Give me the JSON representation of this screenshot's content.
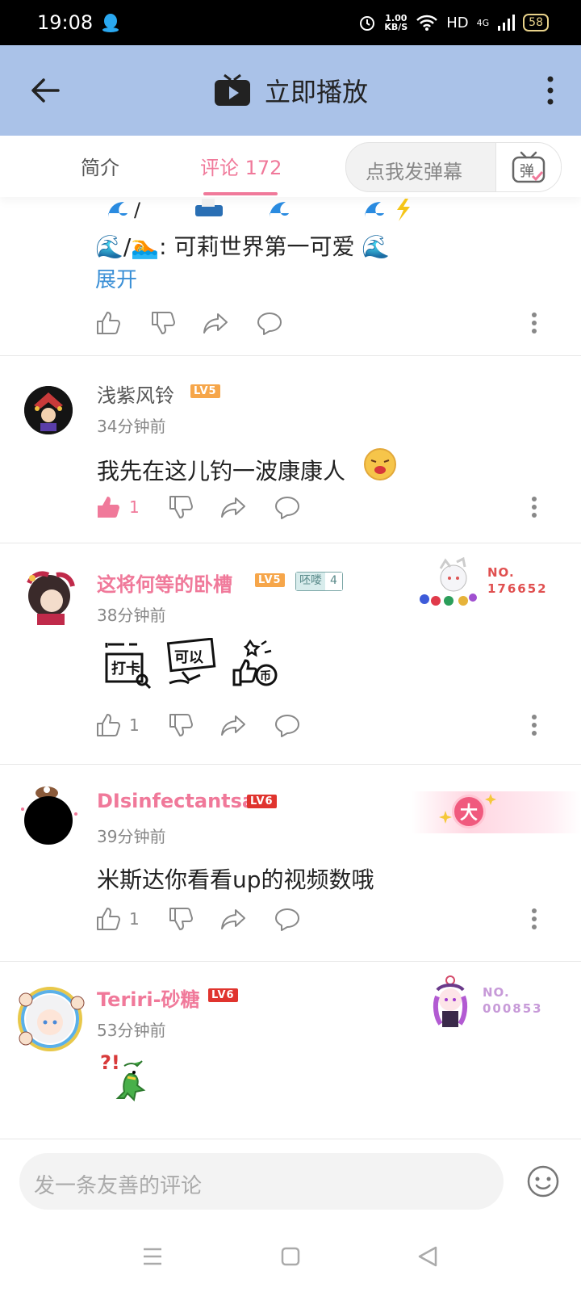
{
  "status_bar": {
    "time": "19:08",
    "speed_value": "1.00",
    "speed_unit": "KB/S",
    "network": "HD",
    "signal": "4G",
    "battery": "58"
  },
  "header": {
    "title": "立即播放"
  },
  "tabs": {
    "intro": "简介",
    "comments": "评论 172",
    "danmaku_placeholder": "点我发弹幕",
    "danmaku_button": "弹"
  },
  "partial_comment": {
    "text": "🌊/🏊: 可莉世界第一可爱 🌊",
    "expand": "展开"
  },
  "comments": [
    {
      "username": "浅紫风铃",
      "level": "LV5",
      "time": "34分钟前",
      "text": "我先在这儿钓一波康康人",
      "likes": "1"
    },
    {
      "username": "这将何等的卧槽",
      "level": "LV5",
      "fan_badge": "呸喽",
      "fan_level": "4",
      "time": "38分钟前",
      "likes": "1",
      "decoration_no": "NO.",
      "decoration_id": "176652",
      "stickers": [
        "打卡",
        "可以",
        "币"
      ]
    },
    {
      "username": "DIsinfectantsa",
      "level": "LV6",
      "time": "39分钟前",
      "text": "米斯达你看看up的视频数哦",
      "likes": "1",
      "decoration_badge": "大"
    },
    {
      "username": "Teriri-砂糖",
      "level": "LV6",
      "time": "53分钟前",
      "decoration_no": "NO.",
      "decoration_id": "000853"
    }
  ],
  "footer": {
    "comment_placeholder": "发一条友善的评论"
  }
}
